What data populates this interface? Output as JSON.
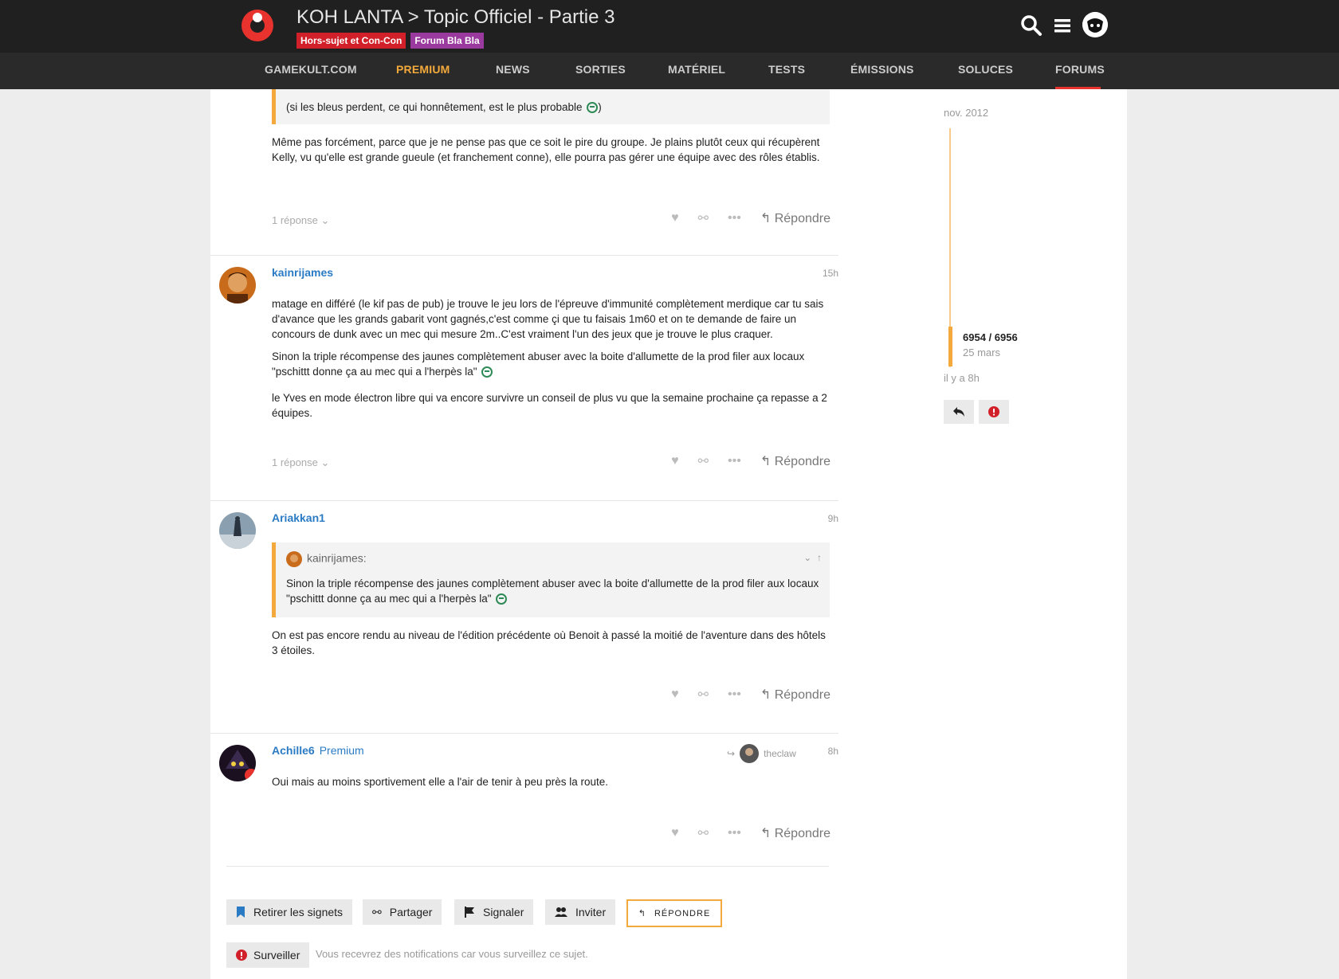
{
  "header": {
    "title": "KOH LANTA > Topic Officiel - Partie 3",
    "tags": [
      "Hors-sujet et Con-Con",
      "Forum Bla Bla"
    ]
  },
  "nav": [
    "GAMEKULT.COM",
    "PREMIUM",
    "NEWS",
    "SORTIES",
    "MATÉRIEL",
    "TESTS",
    "ÉMISSIONS",
    "SOLUCES",
    "FORUMS"
  ],
  "colors": {
    "accent": "#f3a93b",
    "brand_red": "#e8322d",
    "link": "#2b7bc4",
    "tag_purple": "#9a3a9e"
  },
  "posts": [
    {
      "quote_text": "(si les bleus perdent, ce qui honnêtement, est le plus probable",
      "quote_tail": ")",
      "body": [
        "Même pas forcément, parce que je ne pense pas que ce soit le pire du groupe. Je plains plutôt ceux qui récupèrent Kelly, vu qu'elle est grande gueule (et franchement conne), elle pourra pas gérer une équipe avec des rôles établis."
      ],
      "replies": "1 réponse",
      "reply_label": "Répondre"
    },
    {
      "username": "kainrijames",
      "time": "15h",
      "body": [
        "matage en différé (le kif pas de pub) je trouve le jeu lors de l'épreuve d'immunité complètement merdique car tu sais d'avance que les grands gabarit vont gagnés,c'est comme çi que tu faisais 1m60 et on te demande de faire un concours de dunk avec un mec qui mesure 2m..C'est vraiment l'un des jeux que je trouve le plus craquer.",
        "Sinon la triple récompense des jaunes complètement abuser avec la boite d'allumette de la prod filer aux locaux \"pschittt donne ça au mec qui a l'herpès la\"",
        "le Yves en mode électron libre qui va encore survivre un conseil de plus vu que la semaine prochaine ça repasse a 2 équipes."
      ],
      "replies": "1 réponse",
      "reply_label": "Répondre"
    },
    {
      "username": "Ariakkan1",
      "time": "9h",
      "quote_author": "kainrijames:",
      "quote_text": "Sinon la triple récompense des jaunes complètement abuser avec la boite d'allumette de la prod filer aux locaux \"pschittt donne ça au mec qui a l'herpès la\"",
      "body": [
        "On est pas encore rendu au niveau de l'édition précédente où Benoit à passé la moitié de l'aventure dans des hôtels 3 étoiles."
      ],
      "reply_label": "Répondre"
    },
    {
      "username": "Achille6",
      "flair": "Premium",
      "reply_to": "theclaw",
      "time": "8h",
      "body": [
        "Oui mais au moins sportivement elle a l'air de tenir à peu près la route."
      ],
      "reply_label": "Répondre"
    }
  ],
  "timeline": {
    "start": "nov. 2012",
    "position": "6954 / 6956",
    "position_date": "25 mars",
    "ago": "il y a 8h",
    "progress": 0.9997
  },
  "footer": {
    "bookmark": "Retirer les signets",
    "share": "Partager",
    "flag": "Signaler",
    "invite": "Inviter",
    "reply": "RÉPONDRE",
    "watch": "Surveiller",
    "watch_text": "Vous recevrez des notifications car vous surveillez ce sujet."
  }
}
